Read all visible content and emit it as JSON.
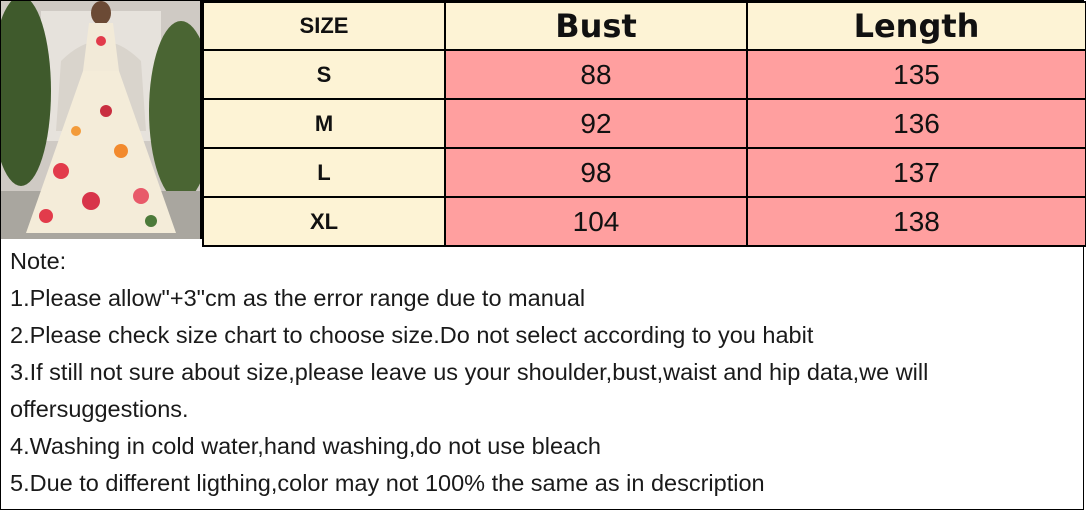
{
  "table": {
    "headers": [
      "SIZE",
      "Bust",
      "Length"
    ],
    "rows": [
      {
        "size": "S",
        "bust": "88",
        "length": "135"
      },
      {
        "size": "M",
        "bust": "92",
        "length": "136"
      },
      {
        "size": "L",
        "bust": "98",
        "length": "137"
      },
      {
        "size": "XL",
        "bust": "104",
        "length": "138"
      }
    ]
  },
  "notes": {
    "heading": "Note:",
    "items": [
      "1.Please allow\"+3\"cm as the error range due to manual",
      "2.Please check size chart to choose size.Do not select according to you habit",
      "3.If still not sure about size,please leave us your shoulder,bust,waist and hip data,we will offersuggestions.",
      "4.Washing in cold water,hand washing,do not use bleach",
      "5.Due to different ligthing,color may not 100% the same as in description"
    ]
  },
  "colors": {
    "header_bg": "#fdf3d5",
    "value_bg": "#ff9f9f",
    "border": "#000000"
  }
}
